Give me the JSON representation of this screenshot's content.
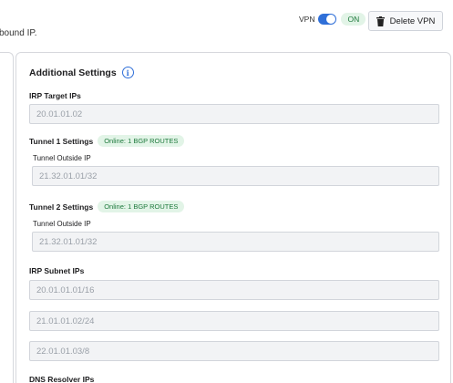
{
  "header": {
    "description_fragment": "bound IP.",
    "vpn_label": "VPN",
    "vpn_toggle_state": "ON",
    "delete_button_label": "Delete VPN"
  },
  "panel": {
    "title": "Additional Settings",
    "irp_target": {
      "label": "IRP Target IPs",
      "value": "20.01.01.02"
    },
    "tunnel1": {
      "label": "Tunnel 1 Settings",
      "status": "Online: 1 BGP ROUTES",
      "outside_ip_label": "Tunnel Outside IP",
      "outside_ip_value": "21.32.01.01/32"
    },
    "tunnel2": {
      "label": "Tunnel 2 Settings",
      "status": "Online: 1 BGP ROUTES",
      "outside_ip_label": "Tunnel Outside IP",
      "outside_ip_value": "21.32.01.01/32"
    },
    "irp_subnet": {
      "label": "IRP Subnet IPs",
      "values": [
        "20.01.01.01/16",
        "21.01.01.02/24",
        "22.01.01.03/8"
      ]
    },
    "dns_resolver": {
      "label": "DNS Resolver IPs"
    }
  },
  "colors": {
    "accent": "#2f6fd8",
    "success_text": "#1f7a3d",
    "success_bg": "#e2f4e7",
    "field_bg": "#f2f3f5",
    "border": "#d6d8dd"
  },
  "icons": [
    "info-icon",
    "trash-icon"
  ]
}
